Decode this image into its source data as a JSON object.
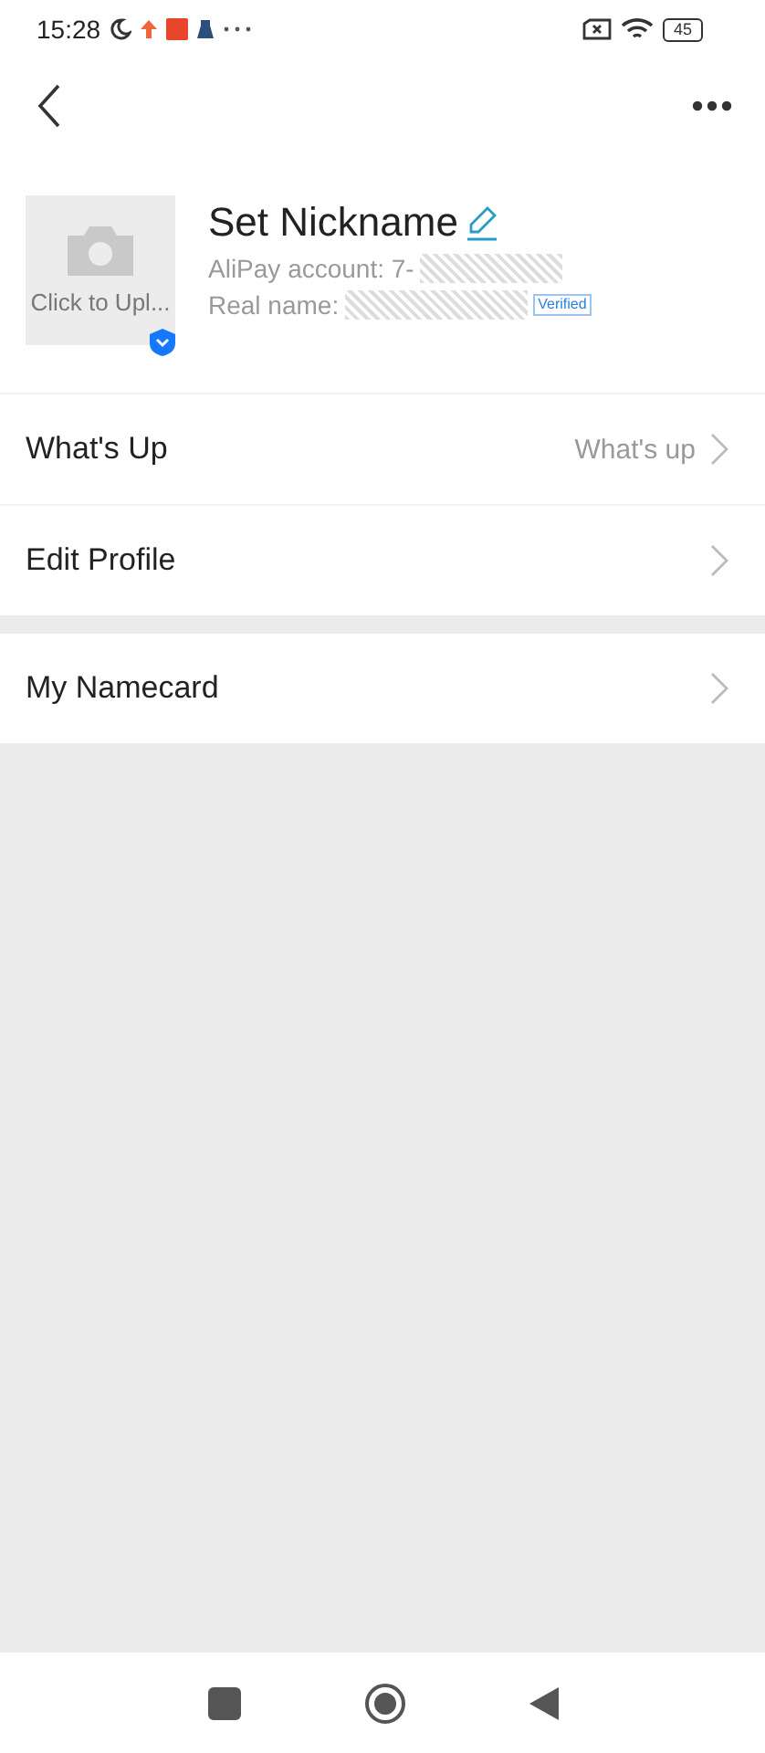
{
  "status_bar": {
    "time": "15:28",
    "battery": "45"
  },
  "profile": {
    "avatar_label": "Click to Upl...",
    "nickname": "Set Nickname",
    "account_label": "AliPay account: 7-",
    "real_name_label": "Real name:",
    "verified_badge": "Verified"
  },
  "menu_groups": [
    [
      {
        "label": "What's Up",
        "value": "What's up"
      },
      {
        "label": "Edit Profile"
      }
    ],
    [
      {
        "label": "My Namecard"
      }
    ]
  ]
}
